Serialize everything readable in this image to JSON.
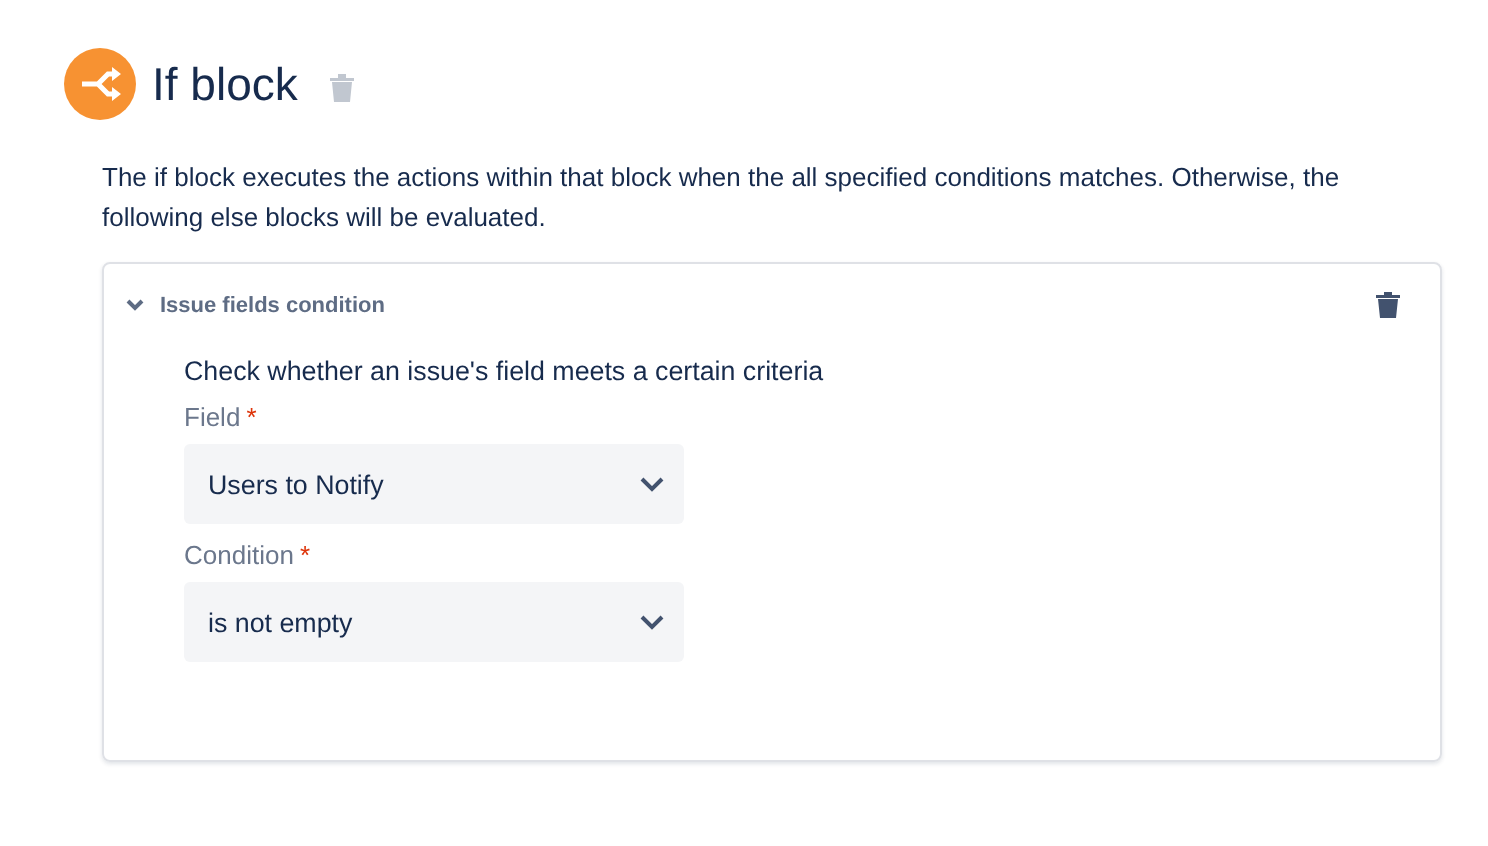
{
  "header": {
    "title": "If block"
  },
  "description": "The if block executes the actions within that block when the all specified conditions matches. Otherwise, the following else blocks will be evaluated.",
  "condition_card": {
    "title": "Issue fields condition",
    "expanded": true,
    "summary": "Check whether an issue's field meets a certain criteria",
    "fields": [
      {
        "label": "Field",
        "required_mark": "*",
        "value": "Users to Notify"
      },
      {
        "label": "Condition",
        "required_mark": "*",
        "value": "is not empty"
      }
    ]
  }
}
